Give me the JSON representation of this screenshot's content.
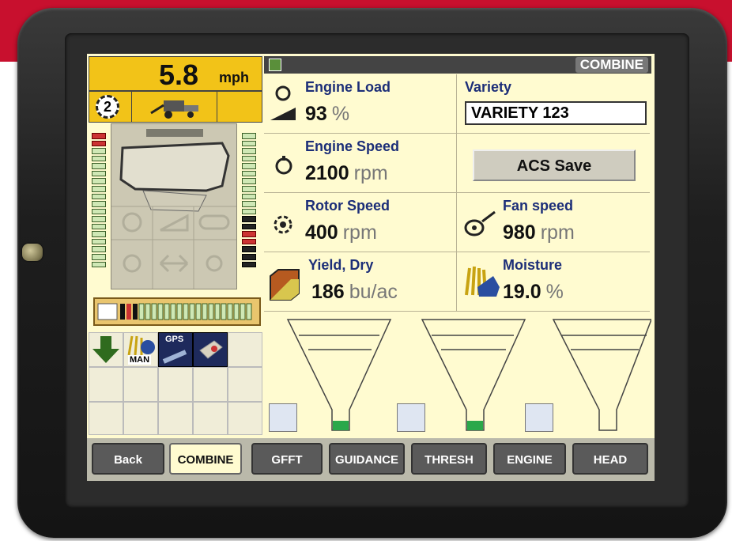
{
  "speed": {
    "value": "5.8",
    "unit": "mph"
  },
  "gear": {
    "number": "2"
  },
  "topbar": {
    "title": "COMBINE"
  },
  "cells": {
    "engine_load": {
      "label": "Engine Load",
      "value": "93",
      "unit": "%"
    },
    "variety": {
      "label": "Variety",
      "value": "VARIETY 123"
    },
    "engine_speed": {
      "label": "Engine Speed",
      "value": "2100",
      "unit": "rpm"
    },
    "acs_save": {
      "label": "ACS Save"
    },
    "rotor_speed": {
      "label": "Rotor Speed",
      "value": "400",
      "unit": "rpm"
    },
    "fan_speed": {
      "label": "Fan speed",
      "value": "980",
      "unit": "rpm"
    },
    "yield_dry": {
      "label": "Yield, Dry",
      "value": "186",
      "unit": "bu/ac"
    },
    "moisture": {
      "label": "Moisture",
      "value": "19.0",
      "unit": "%"
    }
  },
  "tiles": {
    "man_label": "MAN",
    "gps_label": "GPS"
  },
  "tabs": [
    "Back",
    "COMBINE",
    "GFFT",
    "GUIDANCE",
    "THRESH",
    "ENGINE",
    "HEAD"
  ],
  "colors": {
    "accent_yellow": "#f2c318",
    "screen_bg": "#fffbd0",
    "label_blue": "#1c2e78",
    "brand_red": "#c8102e"
  },
  "icons": [
    "gear-icon",
    "combine-icon",
    "engine-icon",
    "rotor-icon",
    "fan-icon",
    "yield-icon",
    "moisture-icon",
    "funnel-icon",
    "arrow-down-icon"
  ]
}
